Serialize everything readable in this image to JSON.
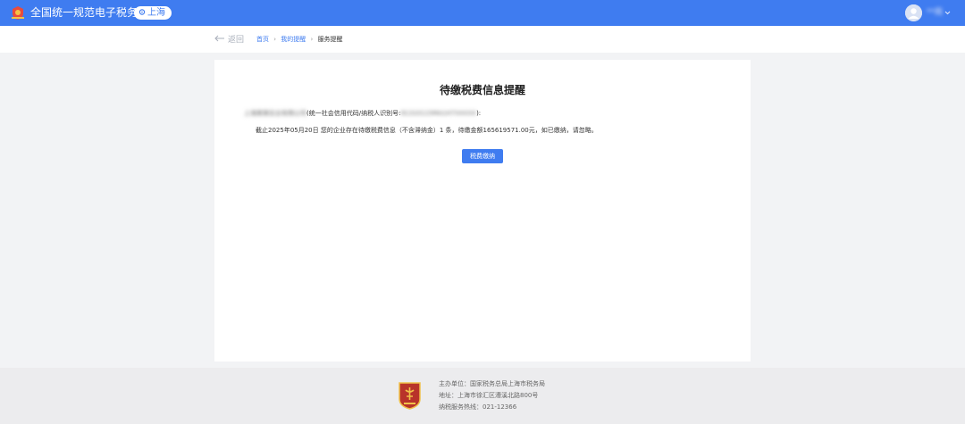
{
  "header": {
    "site_title": "全国统一规范电子税务局",
    "region": "上海",
    "user_name": "**局"
  },
  "nav": {
    "back_label": "返回",
    "breadcrumb": [
      "首页",
      "我的提醒",
      "服务提醒"
    ]
  },
  "notice": {
    "title": "待缴税费信息提醒",
    "taxpayer_name": "上海某某实业有限公司",
    "id_label": "(统一社会信用代码/纳税人识别号:",
    "taxpayer_id": "91310115MA1H7XXXXX",
    "id_label_end": "):",
    "body": "截止2025年05月20日 您的企业存在待缴税费信息（不含滞纳金）1 条，待缴金额165619571.00元，如已缴纳，请忽略。",
    "pay_button": "税费缴纳"
  },
  "footer": {
    "organizer": "主办单位：国家税务总局上海市税务局",
    "address": "地址：上海市徐汇区漕溪北路800号",
    "hotline": "纳税服务热线：021-12366"
  },
  "colors": {
    "primary": "#3f7cf0",
    "emblem_red": "#c0392b"
  }
}
